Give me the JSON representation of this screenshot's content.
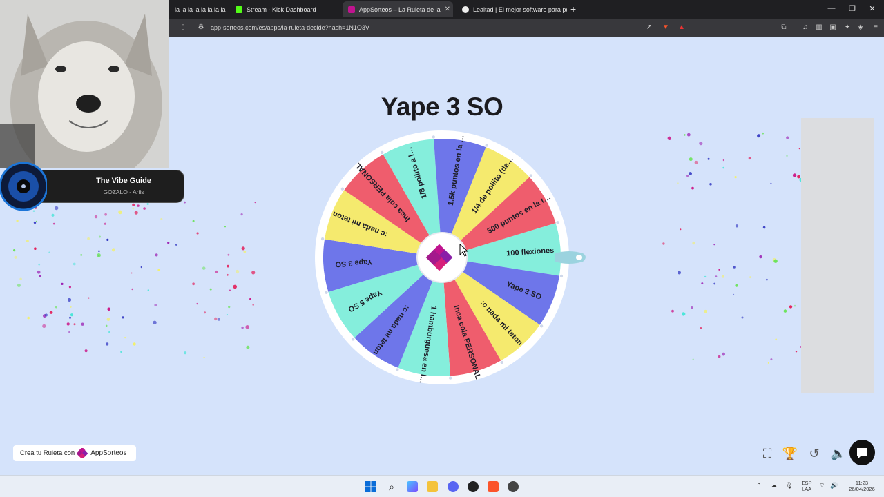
{
  "browser": {
    "tabs": [
      {
        "label": "la la la la la la la la can",
        "active": false
      },
      {
        "label": "Stream - Kick Dashboard",
        "active": false
      },
      {
        "label": "AppSorteos – La Ruleta de la",
        "active": true
      },
      {
        "label": "Lealtad | El mejor software para pote",
        "active": false
      }
    ],
    "url": "app-sorteos.com/es/apps/la-ruleta-decide?hash=1N1O3V"
  },
  "music": {
    "title": "The Vibe Guide",
    "artist": "GOZALO - Ariis"
  },
  "wheel": {
    "title": "Yape 3 SO",
    "segments": [
      {
        "label": "100 flexiones",
        "color": "#85eedc"
      },
      {
        "label": "Yape 3 SO",
        "color": "#6e76ea"
      },
      {
        "label": ":c nada mi teton",
        "color": "#f5ea6e"
      },
      {
        "label": "Inca cola PERSONAL",
        "color": "#ef5d6d"
      },
      {
        "label": "1 hamburguesa en l…",
        "color": "#85eedc"
      },
      {
        "label": ":c nada mi teton",
        "color": "#6e76ea"
      },
      {
        "label": "Yape 5 SO",
        "color": "#85eedc"
      },
      {
        "label": "Yape 3 SO",
        "color": "#6e76ea"
      },
      {
        "label": ":c nada mi teton",
        "color": "#f5ea6e"
      },
      {
        "label": "Inca cola PERSONAL",
        "color": "#ef5d6d"
      },
      {
        "label": "1/8 pollito a l…",
        "color": "#85eedc"
      },
      {
        "label": "1.5k puntos en la …",
        "color": "#6e76ea"
      },
      {
        "label": "1/4 de pollito (de…",
        "color": "#f5ea6e"
      },
      {
        "label": "500 puntos en la t…",
        "color": "#ef5d6d"
      }
    ]
  },
  "footer": {
    "create_label": "Crea tu Ruleta con",
    "brand": "AppSorteos"
  },
  "taskbar": {
    "lang": "ESP",
    "layout": "LAA",
    "time": "11:23",
    "date": "26/04/2026"
  },
  "colors": {
    "background": "#d5e3fb",
    "brand": "#c0148f"
  }
}
